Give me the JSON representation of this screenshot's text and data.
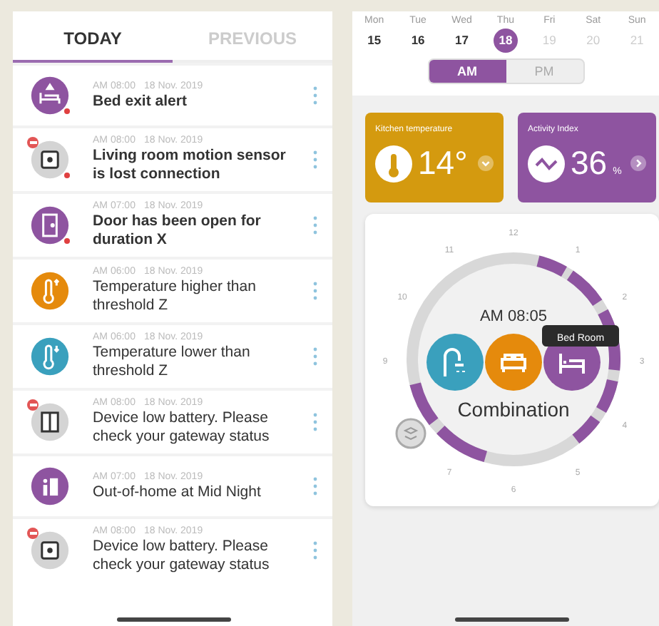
{
  "tabs": [
    {
      "label": "TODAY",
      "selected": true
    },
    {
      "label": "PREVIOUS",
      "selected": false
    }
  ],
  "alerts": [
    {
      "kind": "bed",
      "color": "#8e54a0",
      "time": "AM 08:00",
      "date": "18 Nov. 2019",
      "message": "Bed exit alert",
      "unread": true,
      "alarm": true,
      "offline": false
    },
    {
      "kind": "sensor",
      "color": "#d4d4d4",
      "time": "AM 08:00",
      "date": "18 Nov. 2019",
      "message": "Living room motion sensor is lost connection",
      "unread": true,
      "alarm": true,
      "offline": true
    },
    {
      "kind": "door",
      "color": "#8e54a0",
      "time": "AM 07:00",
      "date": "18 Nov. 2019",
      "message": "Door has been open for duration X",
      "unread": true,
      "alarm": true,
      "offline": false
    },
    {
      "kind": "temp-high",
      "color": "#e58a0c",
      "time": "AM 06:00",
      "date": "18 Nov. 2019",
      "message": "Temperature higher than threshold Z",
      "unread": false,
      "alarm": false,
      "offline": false
    },
    {
      "kind": "temp-low",
      "color": "#3aa0bd",
      "time": "AM 06:00",
      "date": "18 Nov. 2019",
      "message": "Temperature lower than threshold Z",
      "unread": false,
      "alarm": false,
      "offline": false
    },
    {
      "kind": "contact",
      "color": "#d4d4d4",
      "time": "AM 08:00",
      "date": "18 Nov. 2019",
      "message": "Device low battery. Please check your gateway status",
      "unread": false,
      "alarm": false,
      "offline": true
    },
    {
      "kind": "out",
      "color": "#8e54a0",
      "time": "AM 07:00",
      "date": "18 Nov. 2019",
      "message": "Out-of-home at Mid Night",
      "unread": false,
      "alarm": false,
      "offline": false
    },
    {
      "kind": "sensor",
      "color": "#d4d4d4",
      "time": "AM 08:00",
      "date": "18 Nov. 2019",
      "message": "Device low battery. Please check your gateway status",
      "unread": false,
      "alarm": false,
      "offline": true
    }
  ],
  "week": [
    {
      "day": "Mon",
      "date": "15",
      "selected": false,
      "disabled": false
    },
    {
      "day": "Tue",
      "date": "16",
      "selected": false,
      "disabled": false
    },
    {
      "day": "Wed",
      "date": "17",
      "selected": false,
      "disabled": false
    },
    {
      "day": "Thu",
      "date": "18",
      "selected": true,
      "disabled": false
    },
    {
      "day": "Fri",
      "date": "19",
      "selected": false,
      "disabled": true
    },
    {
      "day": "Sat",
      "date": "20",
      "selected": false,
      "disabled": true
    },
    {
      "day": "Sun",
      "date": "21",
      "selected": false,
      "disabled": true
    }
  ],
  "period": [
    {
      "label": "AM",
      "selected": true
    },
    {
      "label": "PM",
      "selected": false
    }
  ],
  "cards": [
    {
      "kind": "temperature",
      "color": "#d49a0f",
      "title": "Kitchen temperature",
      "value": "14°"
    },
    {
      "kind": "activity",
      "color": "#8e54a0",
      "title": "Activity Index",
      "value": "36",
      "unit": "%"
    }
  ],
  "dial": {
    "hours": [
      "12",
      "1",
      "2",
      "3",
      "4",
      "5",
      "6",
      "7",
      "9",
      "10",
      "11"
    ],
    "time": "AM 08:05",
    "label": "Combination",
    "tooltip": "Bed Room",
    "rooms": [
      {
        "kind": "bath",
        "color": "#3aa0bd"
      },
      {
        "kind": "sofa",
        "color": "#e58a0c"
      },
      {
        "kind": "bed",
        "color": "#8e54a0"
      }
    ]
  }
}
